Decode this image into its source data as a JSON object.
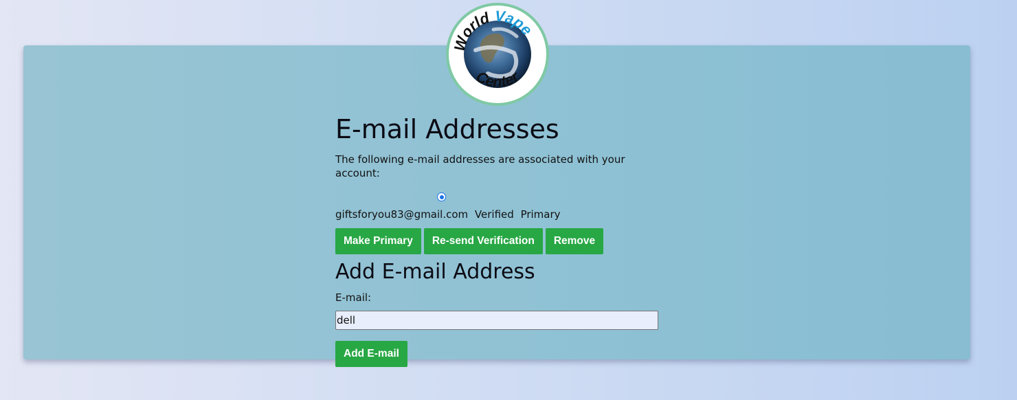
{
  "logo": {
    "top_text": "World Vape",
    "bottom_text": "Center",
    "colors": {
      "world": "#111111",
      "vape": "#1f9bd7",
      "ring": "#7fc9a4"
    }
  },
  "emails_section": {
    "title": "E-mail Addresses",
    "intro": "The following e-mail addresses are associated with your account:",
    "entries": [
      {
        "address": "giftsforyou83@gmail.com",
        "status": "Verified",
        "primary": "Primary",
        "selected": true
      }
    ],
    "actions": {
      "make_primary": "Make Primary",
      "resend": "Re-send Verification",
      "remove": "Remove"
    }
  },
  "add_section": {
    "title": "Add E-mail Address",
    "email_label": "E-mail:",
    "email_value": "dell",
    "submit_label": "Add E-mail"
  },
  "colors": {
    "button": "#28a745",
    "card": "#90c2d4",
    "radio": "#1a73e8"
  }
}
